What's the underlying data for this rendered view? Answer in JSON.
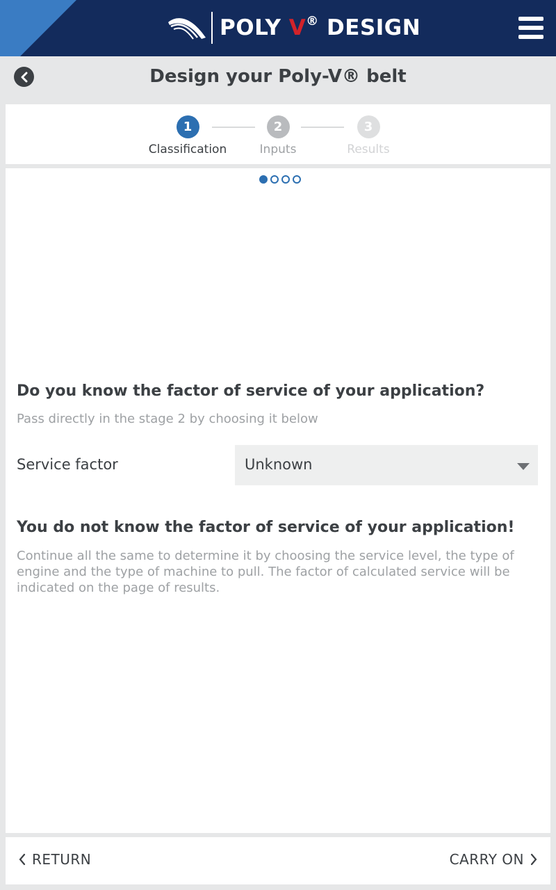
{
  "header": {
    "brand_prefix": "POLY ",
    "brand_v": "V",
    "brand_reg": "®",
    "brand_suffix": " DESIGN",
    "menu_icon": "hamburger-menu-icon"
  },
  "titlebar": {
    "title": "Design your Poly-V® belt",
    "back_icon": "chevron-left-circle-icon"
  },
  "stepper": {
    "steps": [
      {
        "number": "1",
        "label": "Classification",
        "state": "active",
        "color": "#2c6fb1"
      },
      {
        "number": "2",
        "label": "Inputs",
        "state": "upcoming",
        "color": "#b9bbbe"
      },
      {
        "number": "3",
        "label": "Results",
        "state": "disabled",
        "color": "#dedfe0"
      }
    ]
  },
  "pager": {
    "total": 4,
    "current": 1
  },
  "question": {
    "title": "Do you know the factor of service of your application?",
    "subtitle": "Pass directly in the stage 2 by choosing it below"
  },
  "service_factor": {
    "label": "Service factor",
    "selected": "Unknown"
  },
  "unknown_block": {
    "title": "You do not know the factor of service of your application!",
    "text": "Continue all the same to determine it by choosing the service level, the type of engine and the type of machine to pull. The factor of calculated service will be indicated on the page of results."
  },
  "footer": {
    "return_label": "RETURN",
    "carry_label": "CARRY ON"
  },
  "colors": {
    "header_bg": "#132b5c",
    "accent": "#2c6fb1",
    "corner": "#3a7cc3",
    "brand_red": "#d2232a"
  }
}
